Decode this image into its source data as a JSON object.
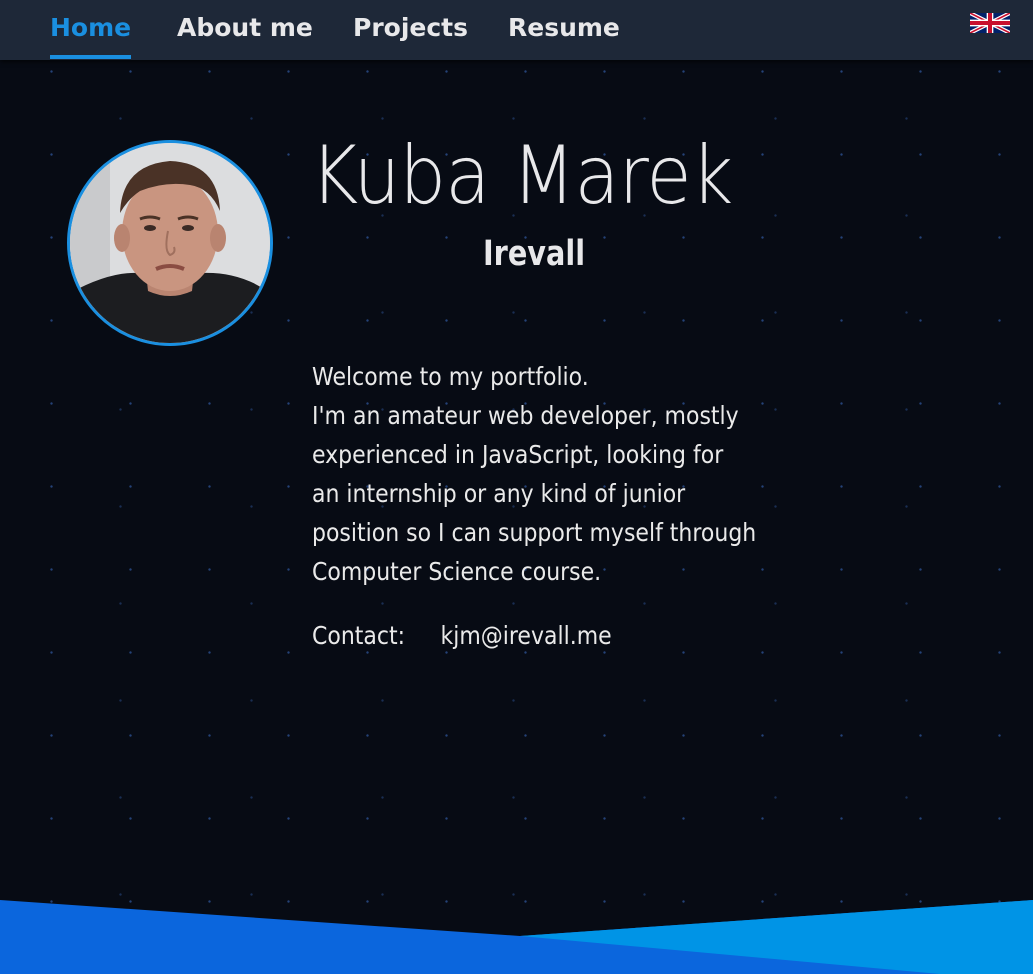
{
  "nav": {
    "items": [
      {
        "label": "Home",
        "active": true
      },
      {
        "label": "About me",
        "active": false
      },
      {
        "label": "Projects",
        "active": false
      },
      {
        "label": "Resume",
        "active": false
      }
    ],
    "language_icon": "uk-flag-icon"
  },
  "profile": {
    "name": "Kuba Marek",
    "nickname": "Irevall",
    "avatar_icon": "profile-photo"
  },
  "bio": {
    "lines": [
      "Welcome to my portfolio.",
      "I'm an amateur web developer, mostly",
      "experienced in JavaScript, looking for",
      "an internship or any kind of junior",
      "position so I can support myself through",
      "Computer Science course."
    ]
  },
  "contact": {
    "label": "Contact:",
    "email": "kjm@irevall.me"
  },
  "colors": {
    "accent": "#1a8fe0",
    "navbar_bg": "#1e2838",
    "page_bg": "#070b14",
    "footer_blue": "#0b66dd",
    "footer_cyan": "#0094e6"
  }
}
